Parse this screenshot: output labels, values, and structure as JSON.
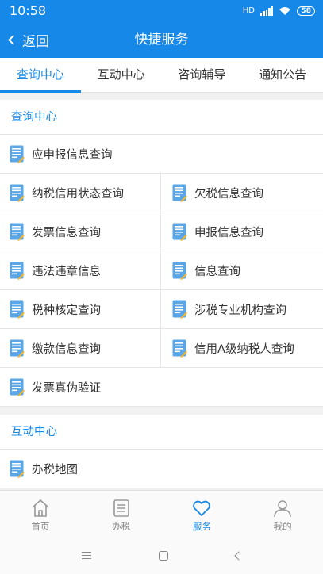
{
  "status_bar": {
    "time": "10:58",
    "network": "HD",
    "battery": "58"
  },
  "header": {
    "back_label": "返回",
    "title": "快捷服务"
  },
  "tabs": [
    {
      "label": "查询中心",
      "active": true
    },
    {
      "label": "互动中心",
      "active": false
    },
    {
      "label": "咨询辅导",
      "active": false
    },
    {
      "label": "通知公告",
      "active": false
    }
  ],
  "query_section": {
    "title": "查询中心",
    "items": {
      "i0": "应申报信息查询",
      "i1": "纳税信用状态查询",
      "i2": "欠税信息查询",
      "i3": "发票信息查询",
      "i4": "申报信息查询",
      "i5": "违法违章信息",
      "i6": "信息查询",
      "i7": "税种核定查询",
      "i8": "涉税专业机构查询",
      "i9": "缴款信息查询",
      "i10": "信用A级纳税人查询",
      "i11": "发票真伪验证"
    }
  },
  "interact_section": {
    "title": "互动中心",
    "items": {
      "i0": "办税地图"
    }
  },
  "bottom_nav": [
    {
      "label": "首页",
      "icon": "home-icon",
      "active": false
    },
    {
      "label": "办税",
      "icon": "list-icon",
      "active": false
    },
    {
      "label": "服务",
      "icon": "heart-icon",
      "active": true
    },
    {
      "label": "我的",
      "icon": "user-icon",
      "active": false
    }
  ],
  "colors": {
    "primary": "#1688e8",
    "icon_doc": "#5aa6e6",
    "pencil": "#f2b631"
  }
}
